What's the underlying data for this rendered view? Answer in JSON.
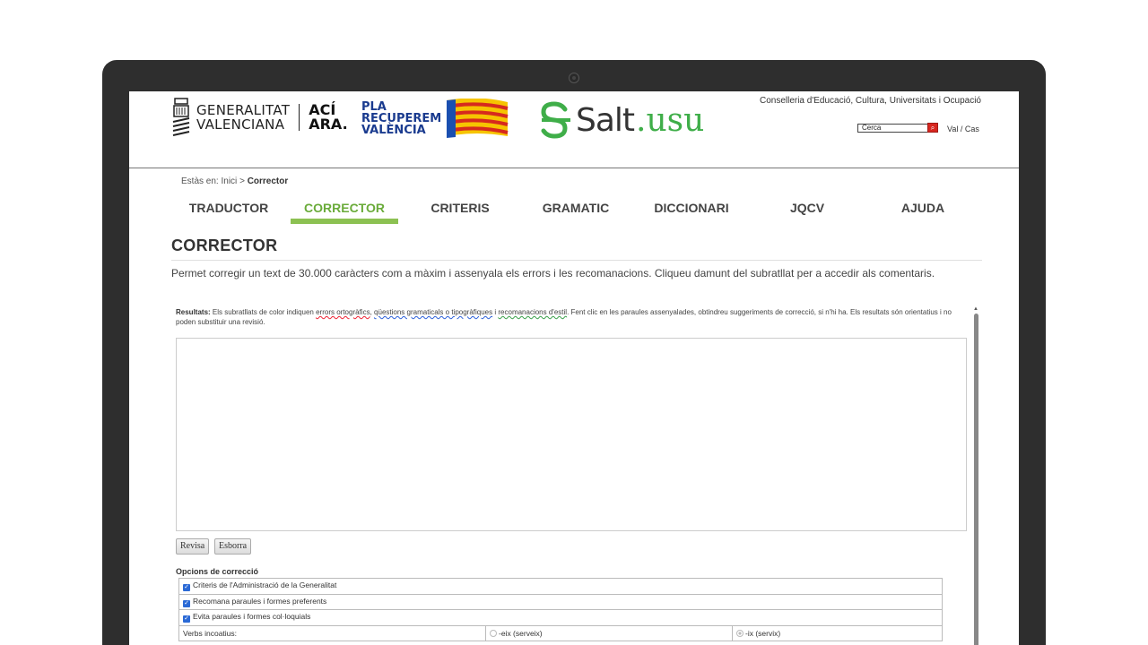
{
  "header": {
    "gv_logo": [
      "GENERALITAT",
      "VALENCIANA"
    ],
    "aci_logo": [
      "ACÍ",
      "ARA."
    ],
    "pla_logo": [
      "PLA",
      "RECUPEREM",
      "VALÈNCIA"
    ],
    "salt_word": "Salt",
    "salt_suffix": ".usu",
    "conselleria": "Conselleria d'Educació, Cultura, Universitats i Ocupació",
    "search_placeholder": "Cerca",
    "lang": "Val / Cas"
  },
  "breadcrumb": {
    "prefix": "Estàs en:",
    "home": "Inici",
    "sep": ">",
    "current": "Corrector"
  },
  "nav": {
    "items": [
      "TRADUCTOR",
      "CORRECTOR",
      "CRITERIS",
      "GRAMATIC",
      "DICCIONARI",
      "JQCV",
      "AJUDA"
    ],
    "active_index": 1
  },
  "page": {
    "title": "CORRECTOR",
    "description": "Permet corregir un text de 30.000 caràcters com a màxim i assenyala els errors i les recomanacions. Cliqueu damunt del subratllat per a accedir als comentaris."
  },
  "results": {
    "label": "Resultats:",
    "intro": "Els subratllats de color indiquen",
    "errors": "errors ortogràfics",
    "comma": ",",
    "grammar": "qüestions gramaticals o tipogràfiques",
    "and": "i",
    "style": "recomanacions d'estil",
    "rest": ". Fent clic en les paraules assenyalades, obtindreu suggeriments de correcció, si n'hi ha. Els resultats són orientatius i no poden substituir una revisió."
  },
  "buttons": {
    "revisa": "Revisa",
    "esborra": "Esborra"
  },
  "options": {
    "title": "Opcions de correcció",
    "checkboxes": [
      "Criteris de l'Administració de la Generalitat",
      "Recomana paraules i formes preferents",
      "Evita paraules i formes col·loquials"
    ],
    "verbs_label": "Verbs incoatius:",
    "verbs_opt1": "-eix (serveix)",
    "verbs_opt2": "-ix (servix)",
    "selected": "-ix (servix)"
  },
  "colors": {
    "accent": "#8cc152",
    "nav_active_text": "#6aab3a",
    "error": "#e23",
    "grammar": "#2b5fd9",
    "style": "#3aa04a"
  }
}
